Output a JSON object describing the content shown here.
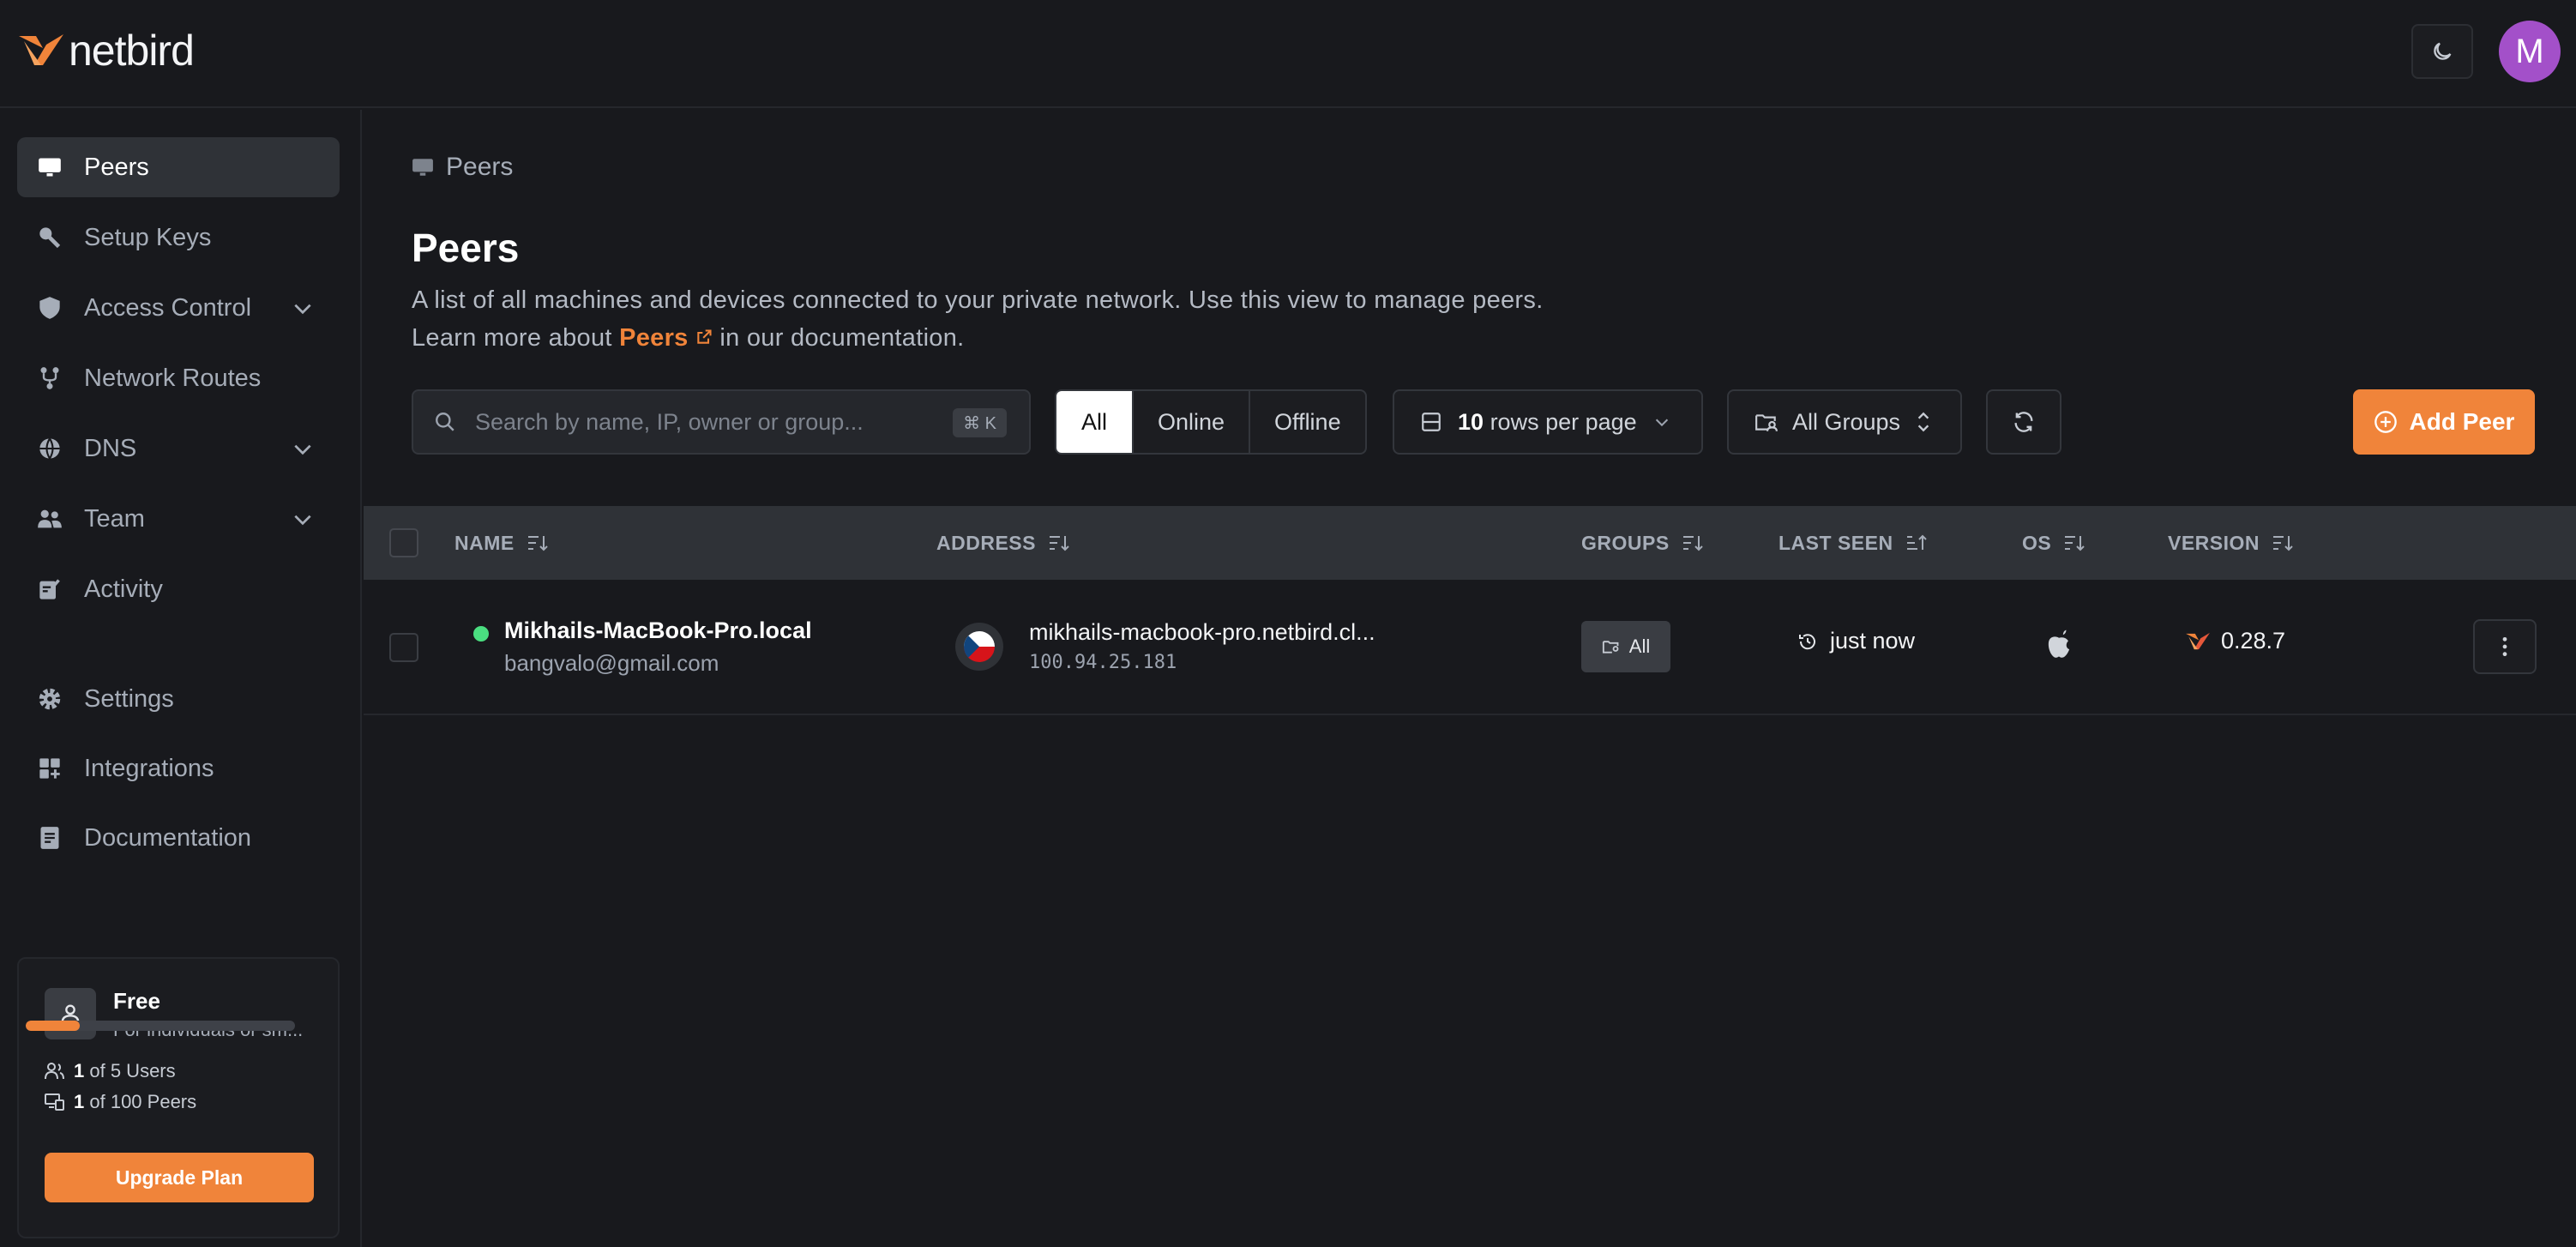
{
  "app": {
    "logo_text": "netbird",
    "avatar_initial": "M"
  },
  "colors": {
    "accent": "#f0843a",
    "avatar": "#a350c9",
    "online": "#4ade80"
  },
  "sidebar": {
    "items": [
      {
        "label": "Peers",
        "icon": "monitor-icon",
        "active": true
      },
      {
        "label": "Setup Keys",
        "icon": "key-icon"
      },
      {
        "label": "Access Control",
        "icon": "shield-icon",
        "expandable": true
      },
      {
        "label": "Network Routes",
        "icon": "route-icon"
      },
      {
        "label": "DNS",
        "icon": "globe-icon",
        "expandable": true
      },
      {
        "label": "Team",
        "icon": "users-icon",
        "expandable": true
      },
      {
        "label": "Activity",
        "icon": "activity-icon"
      },
      {
        "label": "Settings",
        "icon": "gear-icon"
      },
      {
        "label": "Integrations",
        "icon": "grid-plus-icon"
      },
      {
        "label": "Documentation",
        "icon": "document-icon"
      }
    ],
    "plan": {
      "name": "Free",
      "description": "For individuals or sm...",
      "users_used": "1",
      "users_text": "of 5 Users",
      "peers_used": "1",
      "peers_text": "of 100 Peers",
      "progress_fraction": 0.2,
      "upgrade_label": "Upgrade Plan"
    }
  },
  "main": {
    "breadcrumb": "Peers",
    "title": "Peers",
    "description_line1": "A list of all machines and devices connected to your private network. Use this view to manage peers.",
    "description_prefix": "Learn more about",
    "description_link": "Peers",
    "description_suffix": "in our documentation.",
    "search": {
      "placeholder": "Search by name, IP, owner or group...",
      "shortcut": "⌘ K"
    },
    "filters": [
      "All",
      "Online",
      "Offline"
    ],
    "rows_per_page_value": "10",
    "rows_per_page_text": "rows per page",
    "groups_filter": "All Groups",
    "add_button": "Add Peer"
  },
  "table": {
    "columns": [
      "NAME",
      "ADDRESS",
      "GROUPS",
      "LAST SEEN",
      "OS",
      "VERSION"
    ],
    "rows": [
      {
        "name": "Mikhails-MacBook-Pro.local",
        "user": "bangvalo@gmail.com",
        "host": "mikhails-macbook-pro.netbird.cl...",
        "ip": "100.94.25.181",
        "group": "All",
        "last_seen": "just now",
        "os": "apple-icon",
        "version": "0.28.7"
      }
    ]
  }
}
